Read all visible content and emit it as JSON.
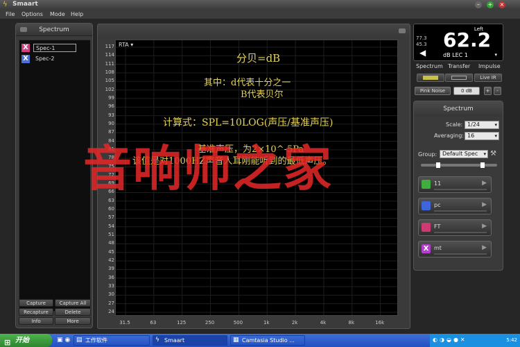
{
  "titlebar": {
    "title": "Smaart"
  },
  "menu": [
    "File",
    "Options",
    "Mode",
    "Help"
  ],
  "left_panel": {
    "header": "Spectrum",
    "specs": [
      {
        "label": "Spec-1",
        "color": "#d04080"
      },
      {
        "label": "Spec-2",
        "color": "#4c6fd6"
      }
    ],
    "buttons": [
      "Capture",
      "Capture All",
      "Recapture",
      "Delete",
      "Info",
      "More"
    ]
  },
  "graph": {
    "mode_label": "RTA ▾",
    "y_ticks": [
      "117",
      "114",
      "111",
      "108",
      "105",
      "102",
      "99",
      "96",
      "93",
      "90",
      "87",
      "84",
      "81",
      "78",
      "75",
      "72",
      "69",
      "66",
      "63",
      "60",
      "57",
      "54",
      "51",
      "48",
      "45",
      "42",
      "39",
      "36",
      "33",
      "30",
      "27",
      "24"
    ],
    "x_ticks": [
      "31.5",
      "63",
      "125",
      "250",
      "500",
      "1k",
      "2k",
      "4k",
      "8k",
      "16k"
    ]
  },
  "overlay_text": {
    "line1": "分贝=dB",
    "line2": "其中：d代表十分之一",
    "line3": "B代表贝尔",
    "line4": "计算式：SPL=10LOG(声压/基准声压)",
    "line5": "基准声压，为2×10^-5Pa",
    "line6": "该值是对1000HZ声音人耳刚能听到的最低声压。"
  },
  "watermark": "音响师之家",
  "meter": {
    "top_label": "Left",
    "value": "62.2",
    "unit": "dB LEC 1",
    "small1": "77.3",
    "small2": "45.3"
  },
  "tabs": [
    "Spectrum",
    "Transfer",
    "Impulse"
  ],
  "live_ir": "Live IR",
  "pink_noise": {
    "label": "Pink Noise",
    "level": "0 dB",
    "plus": "+",
    "minus": "-"
  },
  "settings": {
    "header": "Spectrum",
    "scale_label": "Scale:",
    "scale_value": "1/24",
    "averaging_label": "Averaging:",
    "averaging_value": "16",
    "group_label": "Group:",
    "group_value": "Default Spec"
  },
  "traces": [
    {
      "name": "11",
      "color": "#3fae3f"
    },
    {
      "name": "pc",
      "color": "#3f66d8"
    },
    {
      "name": "FT",
      "color": "#d03a72"
    },
    {
      "name": "mt",
      "color": "#b33fcc"
    }
  ],
  "taskbar": {
    "start": "开始",
    "tasks": [
      "工作软件",
      "Smaart",
      "Camtasia Studio ..."
    ],
    "clock": "5:42"
  }
}
